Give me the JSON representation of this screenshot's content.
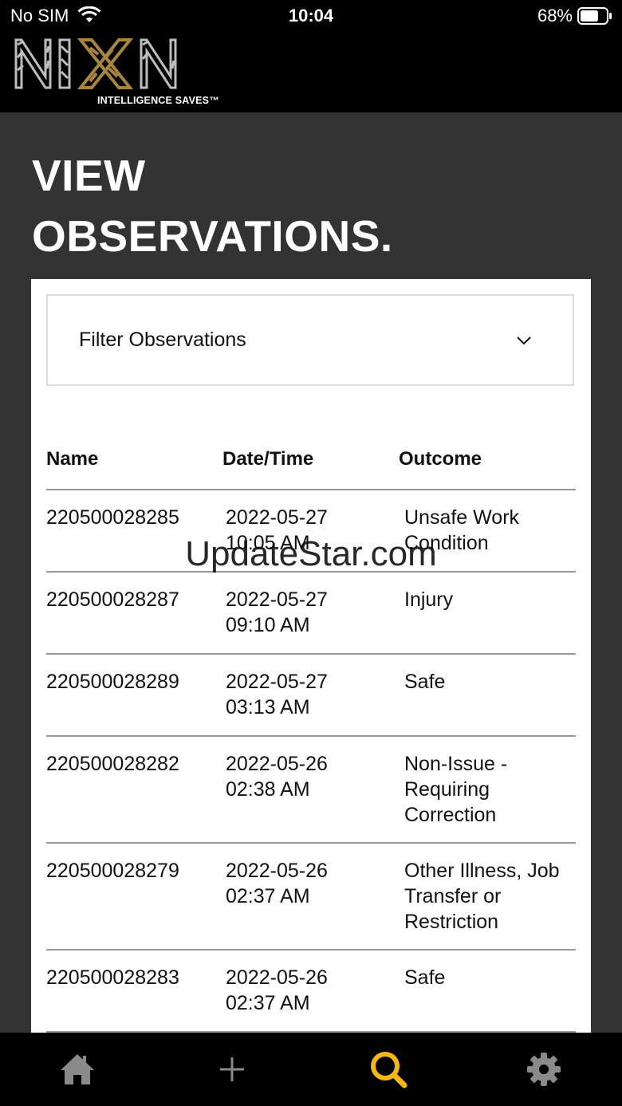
{
  "status_bar": {
    "carrier": "No SIM",
    "time": "10:04",
    "battery": "68%"
  },
  "brand": {
    "logo_text": "NIXN",
    "tagline": "INTELLIGENCE SAVES™",
    "accent_color": "#a88538"
  },
  "page": {
    "title_line1": "VIEW",
    "title_line2": "OBSERVATIONS."
  },
  "filter": {
    "label": "Filter Observations"
  },
  "table": {
    "headers": [
      "Name",
      "Date/Time",
      "Outcome"
    ],
    "rows": [
      {
        "name": "220500028285",
        "date": "2022-05-27",
        "time": "10:05 AM",
        "outcome": "Unsafe Work Condition"
      },
      {
        "name": "220500028287",
        "date": "2022-05-27",
        "time": "09:10 AM",
        "outcome": "Injury"
      },
      {
        "name": "220500028289",
        "date": "2022-05-27",
        "time": "03:13 AM",
        "outcome": "Safe"
      },
      {
        "name": "220500028282",
        "date": "2022-05-26",
        "time": "02:38 AM",
        "outcome": "Non-Issue - Requiring Correction"
      },
      {
        "name": "220500028279",
        "date": "2022-05-26",
        "time": "02:37 AM",
        "outcome": "Other Illness, Job Transfer or Restriction"
      },
      {
        "name": "220500028283",
        "date": "2022-05-26",
        "time": "02:37 AM",
        "outcome": "Safe"
      }
    ]
  },
  "watermark": "UpdateStar.com",
  "nav": {
    "active_color": "#f5b80f",
    "inactive_color": "#8a8a8a",
    "items": [
      "home-icon",
      "plus-icon",
      "search-icon",
      "gear-icon"
    ]
  }
}
